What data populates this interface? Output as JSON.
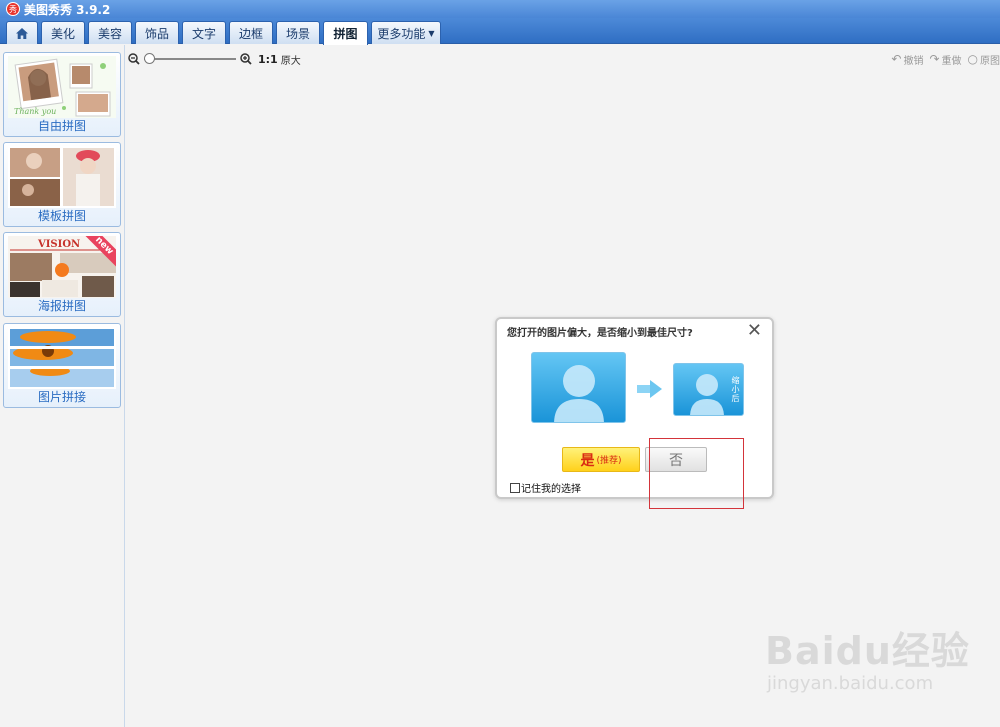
{
  "app": {
    "title": "美图秀秀 3.9.2",
    "logo_text": "秀",
    "logo_color": "#e8352e"
  },
  "tabs": [
    {
      "label": "",
      "icon": "home-icon"
    },
    {
      "label": "美化"
    },
    {
      "label": "美容"
    },
    {
      "label": "饰品"
    },
    {
      "label": "文字"
    },
    {
      "label": "边框"
    },
    {
      "label": "场景"
    },
    {
      "label": "拼图",
      "active": true
    },
    {
      "label": "更多功能"
    }
  ],
  "sidebar": {
    "items": [
      {
        "label": "自由拼图"
      },
      {
        "label": "模板拼图"
      },
      {
        "label": "海报拼图",
        "thumb_heading": "VISION",
        "badge": "new"
      },
      {
        "label": "图片拼接"
      }
    ]
  },
  "zoom": {
    "ratio": "1:1",
    "original": "原大",
    "level": 0
  },
  "toolbar_right": {
    "undo": "撤销",
    "redo": "重做",
    "original": "原图"
  },
  "dialog": {
    "title": "您打开的图片偏大，是否缩小到最佳尺寸?",
    "small_note": "缩小后",
    "yes_main": "是",
    "yes_sub": "(推荐)",
    "no": "否",
    "remember": "记住我的选择",
    "accent": "#1a94d8"
  },
  "watermark": {
    "main": "Baidu经验",
    "sub": "jingyan.baidu.com"
  }
}
